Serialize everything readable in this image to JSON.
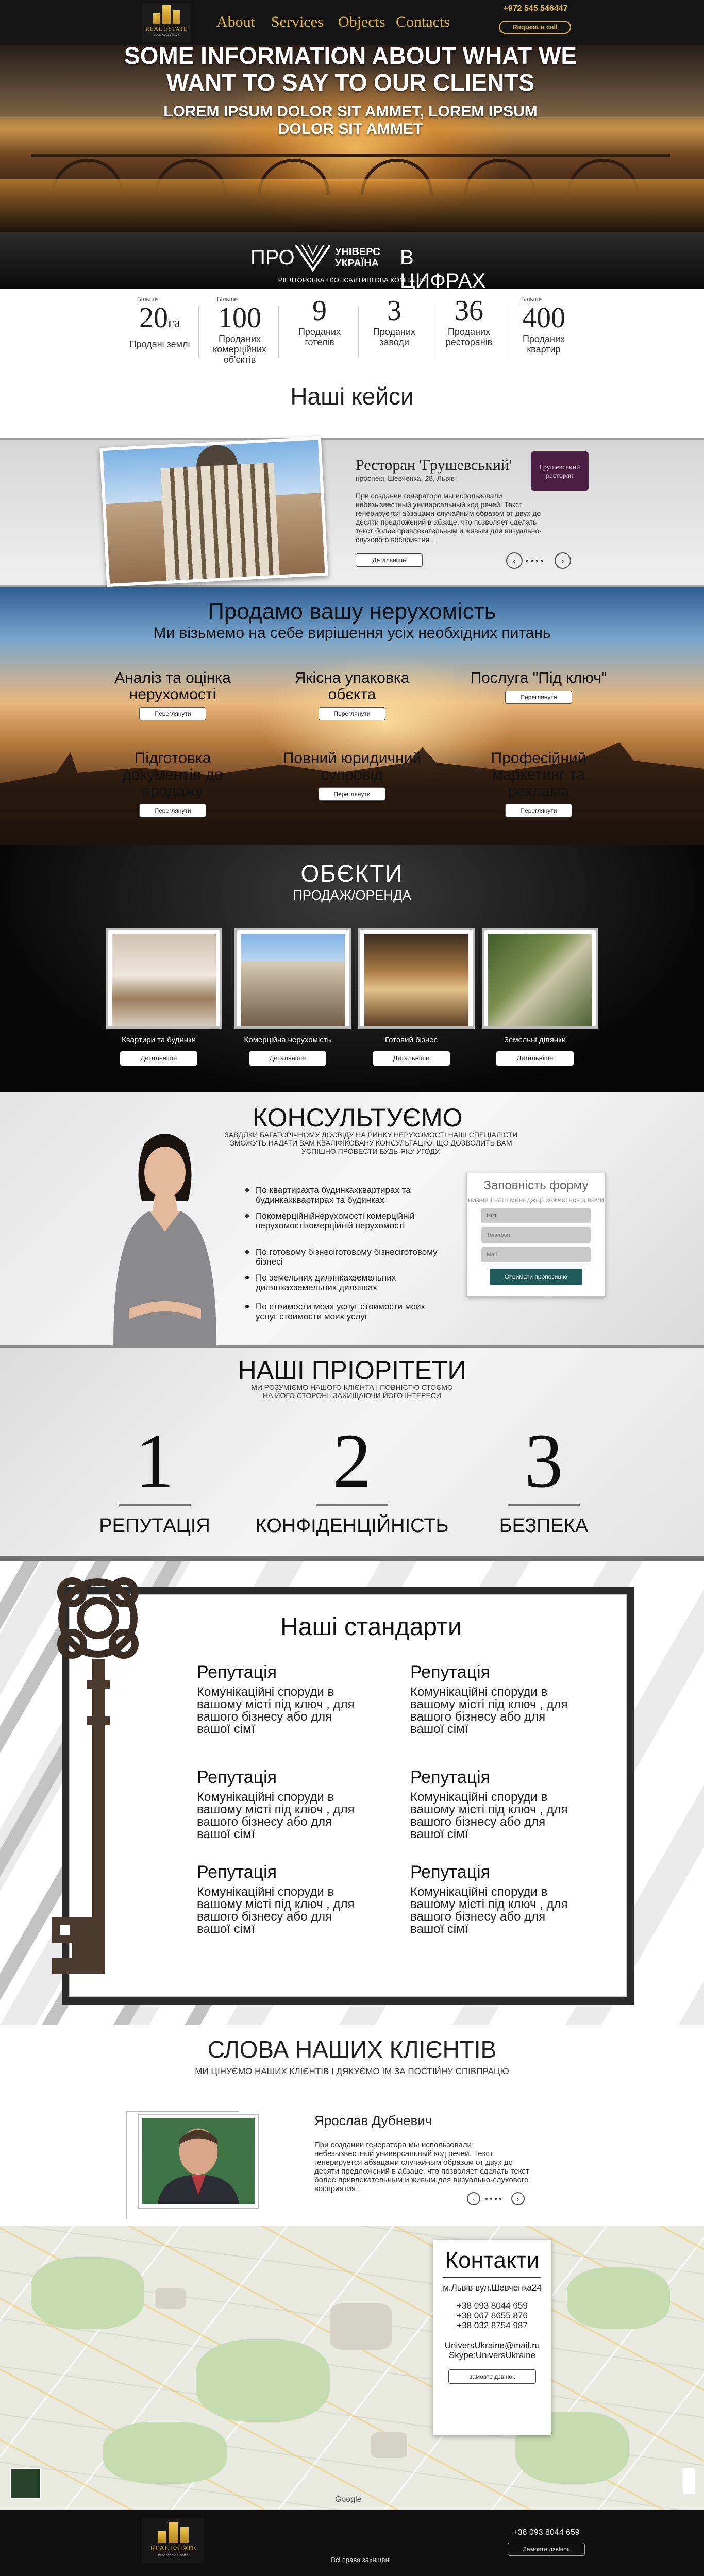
{
  "header": {
    "logo_title": "REAL ESTATE",
    "logo_tagline": "Impeccable Choice",
    "nav": [
      "About",
      "Services",
      "Objects",
      "Contacts"
    ],
    "phone": "+972 545 546447",
    "request_label": "Request a call"
  },
  "hero": {
    "headline": "SOME INFORMATION ABOUT WHAT WE WANT TO SAY TO OUR CLIENTS",
    "subline": "LOREM IPSUM DOLOR SIT AMMET, LOREM IPSUM DOLOR SIT AMMET"
  },
  "stats": {
    "title_pre": "ПРО",
    "brand_line1": "УНІВЕРС",
    "brand_line2": "УКРАЇНА",
    "title_post": "В ЦИФРАХ",
    "subtitle": "РІЕЛТОРСЬКА І КОНСАЛТИНГОВА КОМПАНІЯ",
    "items": [
      {
        "pre": "Більше",
        "num": "20",
        "unit": "га",
        "label": "Продані землі"
      },
      {
        "pre": "Більше",
        "num": "100",
        "unit": "",
        "label": "Проданих комерційних об'єктів"
      },
      {
        "pre": "",
        "num": "9",
        "unit": "",
        "label": "Проданих готелів"
      },
      {
        "pre": "",
        "num": "3",
        "unit": "",
        "label": "Проданих заводи"
      },
      {
        "pre": "",
        "num": "36",
        "unit": "",
        "label": "Проданих ресторанів"
      },
      {
        "pre": "Більше",
        "num": "400",
        "unit": "",
        "label": "Проданих квартир"
      }
    ]
  },
  "cases": {
    "heading": "Наші кейси",
    "title": "Ресторан 'Грушевський'",
    "address": "проспект Шевченка, 28, Львів",
    "logo_text": "Грушевський ресторан",
    "text": "При создании генератора мы использовали небезызвестный универсальный код речей. Текст генерируется абзацами случайным образом от двух до десяти предложений в абзаце, что позволяет сделать текст более привлекательным и живым для визуально-слухового восприятия...",
    "button": "Детальніше",
    "prev": "‹",
    "next": "›"
  },
  "sell": {
    "heading": "Продамо вашу нерухомість",
    "subheading": "Ми візьмемо на себе вирішення усіх необхідних питань",
    "services": [
      {
        "title": "Аналіз та оцінка нерухомості",
        "button": "Переглянути"
      },
      {
        "title": "Якісна упаковка обєкта",
        "button": "Переглянути"
      },
      {
        "title": "Послуга \"Під ключ\"",
        "button": "Переглянути"
      },
      {
        "title": "Підготовка документів до продажу",
        "button": "Переглянути"
      },
      {
        "title": "Повний юридичний супровід",
        "button": "Переглянути"
      },
      {
        "title": "Професійний маркетинг та реклама",
        "button": "Переглянути"
      }
    ]
  },
  "objects": {
    "heading": "ОБЄКТИ",
    "subheading": "ПРОДАЖ/ОРЕНДА",
    "cards": [
      {
        "label": "Квартири та будинки",
        "button": "Детальніше"
      },
      {
        "label": "Комерційна нерухомість",
        "button": "Детальніше"
      },
      {
        "label": "Готовий бізнес",
        "button": "Детальніше"
      },
      {
        "label": "Земельні ділянки",
        "button": "Детальніше"
      }
    ]
  },
  "consult": {
    "heading": "КОНСУЛЬТУЄМО",
    "subtitle": "ЗАВДЯКИ БАГАТОРІЧНОМУ ДОСВІДУ НА РИНКУ НЕРУХОМОСТІ НАШІ СПЕЦІАЛІСТИ ЗМОЖУТЬ НАДАТИ ВАМ КВАЛІФІКОВАНУ КОНСУЛЬТАЦІЮ, ЩО ДОЗВОЛИТЬ ВАМ УСПІШНО ПРОВЕСТИ БУДЬ-ЯКУ УГОДУ.",
    "items": [
      "По квартирахта будинкахквартирах та будинкахквартирах та будинках",
      "Покомерційнійнерухомості комерційній нерухомостікомерційній нерухомості",
      "По готовому бізнесіготовому бізнесіготовому бізнесі",
      "По земельних дилянкахземельних дилянкахземельних дилянках",
      "По стоимости моих услуг  стоимости моих услуг  стоимости моих услуг"
    ],
    "form": {
      "title": "Заповність форму",
      "subtitle": "нижче і наш менеджер звжиється з вами",
      "name_placeholder": "Ім'я",
      "phone_placeholder": "Телефон",
      "email_placeholder": "Mail",
      "submit": "Отримати пропозицію"
    }
  },
  "priorities": {
    "heading": "НАШІ ПРІОРІТЕТИ",
    "subtitle": "МИ РОЗУМІЄМО НАШОГО КЛІЄНТА І ПОВНІСТЮ СТОЄМО НА ЙОГО СТОРОНІ: ЗАХИЩАЮЧИ ЙОГО ІНТЕРЕСИ",
    "items": [
      {
        "num": "1",
        "label": "РЕПУТАЦІЯ"
      },
      {
        "num": "2",
        "label": "КОНФІДЕНЦІЙНІСТЬ"
      },
      {
        "num": "3",
        "label": "БЕЗПЕКА"
      }
    ]
  },
  "standards": {
    "heading": "Наші стандарти",
    "items": [
      {
        "title": "Репутація",
        "text": "Комунікаційні споруди в вашому місті під ключ , для вашого бізнесу або для вашої сімї"
      },
      {
        "title": "Репутація",
        "text": "Комунікаційні споруди в вашому місті під ключ , для вашого бізнесу або для вашої сімї"
      },
      {
        "title": "Репутація",
        "text": "Комунікаційні споруди в  вашому місті під ключ , для вашого бізнесу або для вашої сімї"
      },
      {
        "title": "Репутація",
        "text": "Комунікаційні споруди в вашому місті під ключ , для вашого бізнесу або для вашої сімї"
      },
      {
        "title": "Репутація",
        "text": "Комунікаційні споруди в вашому місті під ключ , для вашого бізнесу або для вашої сімї"
      },
      {
        "title": "Репутація",
        "text": "Комунікаційні споруди в вашому місті під ключ , для вашого бізнесу або для вашої сімї"
      }
    ]
  },
  "testimonials": {
    "heading": "СЛОВА НАШИХ КЛІЄНТІВ",
    "subtitle": "МИ ЦІНУЄМО НАШИХ КЛІЄНТІВ І ДЯКУЄМО ЇМ ЗА ПОСТІЙНУ СПІВПРАЦЮ",
    "name": "Ярослав Дубневич",
    "text": "При создании генератора мы использовали небезызвестный универсальный код речей. Текст генерируется абзацами случайным образом от двух до десяти предложений в абзаце, что позволяет сделать текст более привлекательным и живым для визуально-слухового восприятия...",
    "prev": "‹",
    "next": "›"
  },
  "contacts": {
    "heading": "Контакти",
    "address": "м.Львів вул.Шевченка24",
    "phones": [
      "+38 093 8044 659",
      "+38 067 8655 876",
      "+38 032 8754 987"
    ],
    "email": "UniversUkraine@mail.ru",
    "skype": "Skype:UniversUkraine",
    "button": "замовте дзвінок",
    "map_brand": "Google"
  },
  "footer": {
    "logo_title": "REAL ESTATE",
    "logo_tagline": "Impeccable Choice",
    "copyright": "Всі права захищені",
    "phone": "+38 093 8044 659",
    "button": "Замовте дзвінок"
  },
  "colors": {
    "gold": "#e0b446",
    "dark": "#141414",
    "form_button": "#1f5b5a"
  }
}
